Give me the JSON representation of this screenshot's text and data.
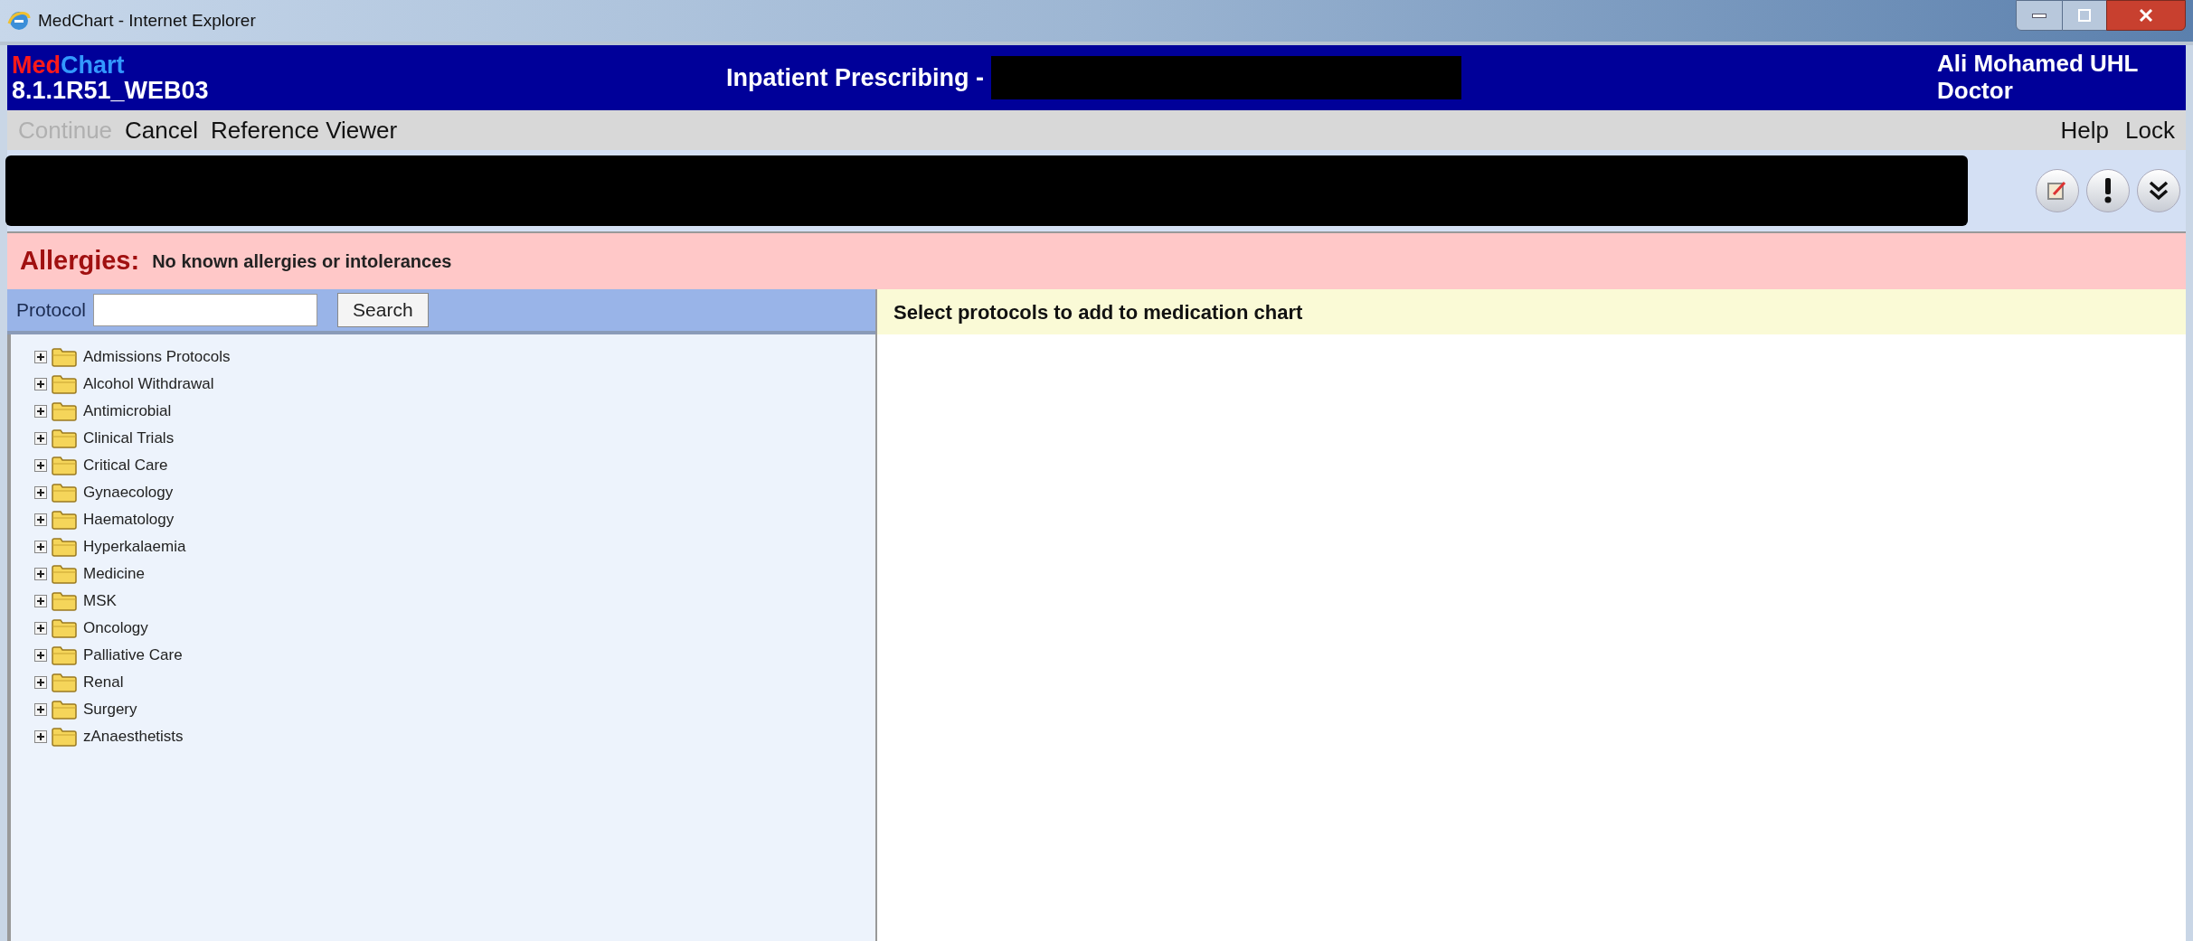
{
  "window": {
    "title": "MedChart - Internet Explorer"
  },
  "header": {
    "logo_part_1": "Med",
    "logo_part_2": "Chart",
    "version": "8.1.1R51_WEB03",
    "title": "Inpatient Prescribing -",
    "user": "Ali Mohamed UHL",
    "role": "Doctor"
  },
  "menu": {
    "left": [
      {
        "label": "Continue",
        "disabled": true
      },
      {
        "label": "Cancel",
        "disabled": false
      },
      {
        "label": "Reference Viewer",
        "disabled": false
      }
    ],
    "right": [
      {
        "label": "Help",
        "disabled": false
      },
      {
        "label": "Lock",
        "disabled": false
      }
    ]
  },
  "allergies": {
    "label": "Allergies:",
    "text": "No known allergies or intolerances"
  },
  "protocol_search": {
    "label": "Protocol",
    "button": "Search"
  },
  "tree": [
    {
      "label": "Admissions Protocols",
      "expanded": false
    },
    {
      "label": "Alcohol Withdrawal",
      "expanded": false
    },
    {
      "label": "Antimicrobial",
      "expanded": false
    },
    {
      "label": "Clinical Trials",
      "expanded": false
    },
    {
      "label": "Critical Care",
      "expanded": false
    },
    {
      "label": "Gynaecology",
      "expanded": false
    },
    {
      "label": "Haematology",
      "expanded": false
    },
    {
      "label": "Hyperkalaemia",
      "expanded": false
    },
    {
      "label": "Medicine",
      "expanded": false
    },
    {
      "label": "MSK",
      "expanded": false
    },
    {
      "label": "Oncology",
      "expanded": false
    },
    {
      "label": "Palliative Care",
      "expanded": false
    },
    {
      "label": "Renal",
      "expanded": false
    },
    {
      "label": "Surgery",
      "expanded": false
    },
    {
      "label": "zAnaesthetists",
      "expanded": false
    }
  ],
  "main_panel": {
    "heading": "Select protocols to add to medication chart"
  }
}
